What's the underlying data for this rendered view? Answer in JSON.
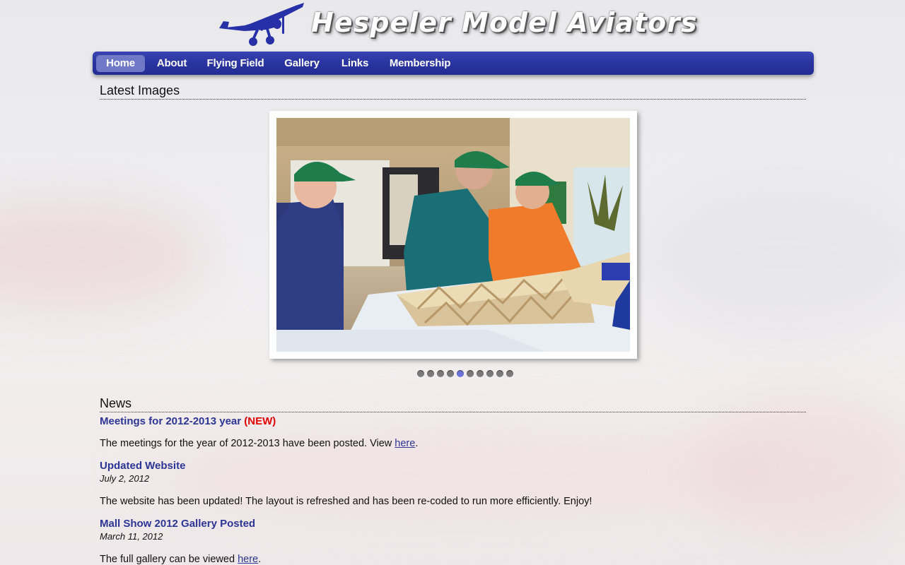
{
  "site": {
    "title": "Hespeler Model Aviators"
  },
  "nav": {
    "items": [
      {
        "label": "Home",
        "active": true
      },
      {
        "label": "About"
      },
      {
        "label": "Flying Field"
      },
      {
        "label": "Gallery"
      },
      {
        "label": "Links"
      },
      {
        "label": "Membership"
      }
    ]
  },
  "latest_images": {
    "heading": "Latest Images",
    "slide_count": 10,
    "active_slide": 5
  },
  "news": {
    "heading": "News",
    "items": [
      {
        "title": "Meetings for 2012-2013 year",
        "badge": "(NEW)",
        "body_prefix": "The meetings for the year of 2012-2013 have been posted. View ",
        "link": "here",
        "body_suffix": "."
      },
      {
        "title": "Updated Website",
        "date": "July 2, 2012",
        "body": "The website has been updated! The layout is refreshed and has been re-coded to run more efficiently. Enjoy!"
      },
      {
        "title": "Mall Show 2012 Gallery Posted",
        "date": "March 11, 2012",
        "body_prefix": "The full gallery can be viewed ",
        "link": "here",
        "body_suffix": "."
      }
    ]
  },
  "colors": {
    "nav_blue": "#2a34a0",
    "active_tab": "#6f79c8",
    "news_title": "#2c3595",
    "new_badge": "#e00000"
  }
}
